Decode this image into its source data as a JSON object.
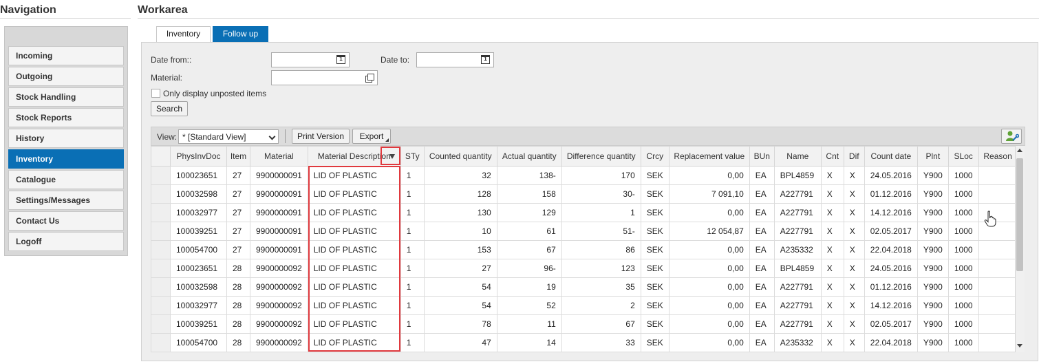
{
  "nav": {
    "title": "Navigation",
    "items": [
      "Incoming",
      "Outgoing",
      "Stock Handling",
      "Stock Reports",
      "History",
      "Inventory",
      "Catalogue",
      "Settings/Messages",
      "Contact Us",
      "Logoff"
    ],
    "active_index": 5
  },
  "work": {
    "title": "Workarea",
    "tabs": [
      "Inventory",
      "Follow up"
    ],
    "active_tab": 1
  },
  "filters": {
    "date_from_label": "Date from::",
    "date_to_label": "Date to:",
    "material_label": "Material:",
    "date_from_value": "",
    "date_to_value": "",
    "material_value": "",
    "checkbox_label": "Only display unposted items",
    "checkbox_checked": false,
    "search_label": "Search"
  },
  "toolbar": {
    "view_label": "View:",
    "view_value": "* [Standard View]",
    "print_label": "Print Version",
    "export_label": "Export"
  },
  "table": {
    "headers": [
      "PhysInvDoc",
      "Item",
      "Material",
      "Material Description",
      "STy",
      "Counted quantity",
      "Actual quantity",
      "Difference quantity",
      "Crcy",
      "Replacement value",
      "BUn",
      "Name",
      "Cnt",
      "Dif",
      "Count date",
      "Plnt",
      "SLoc",
      "Reason"
    ],
    "rows": [
      [
        "100023651",
        "27",
        "9900000091",
        "LID OF PLASTIC",
        "1",
        "32",
        "138-",
        "170",
        "SEK",
        "0,00",
        "EA",
        "BPL4859",
        "X",
        "X",
        "24.05.2016",
        "Y900",
        "1000",
        ""
      ],
      [
        "100032598",
        "27",
        "9900000091",
        "LID OF PLASTIC",
        "1",
        "128",
        "158",
        "30-",
        "SEK",
        "7 091,10",
        "EA",
        "A227791",
        "X",
        "X",
        "01.12.2016",
        "Y900",
        "1000",
        ""
      ],
      [
        "100032977",
        "27",
        "9900000091",
        "LID OF PLASTIC",
        "1",
        "130",
        "129",
        "1",
        "SEK",
        "0,00",
        "EA",
        "A227791",
        "X",
        "X",
        "14.12.2016",
        "Y900",
        "1000",
        ""
      ],
      [
        "100039251",
        "27",
        "9900000091",
        "LID OF PLASTIC",
        "1",
        "10",
        "61",
        "51-",
        "SEK",
        "12 054,87",
        "EA",
        "A227791",
        "X",
        "X",
        "02.05.2017",
        "Y900",
        "1000",
        ""
      ],
      [
        "100054700",
        "27",
        "9900000091",
        "LID OF PLASTIC",
        "1",
        "153",
        "67",
        "86",
        "SEK",
        "0,00",
        "EA",
        "A235332",
        "X",
        "X",
        "22.04.2018",
        "Y900",
        "1000",
        ""
      ],
      [
        "100023651",
        "28",
        "9900000092",
        "LID OF PLASTIC",
        "1",
        "27",
        "96-",
        "123",
        "SEK",
        "0,00",
        "EA",
        "BPL4859",
        "X",
        "X",
        "24.05.2016",
        "Y900",
        "1000",
        ""
      ],
      [
        "100032598",
        "28",
        "9900000092",
        "LID OF PLASTIC",
        "1",
        "54",
        "19",
        "35",
        "SEK",
        "0,00",
        "EA",
        "A227791",
        "X",
        "X",
        "01.12.2016",
        "Y900",
        "1000",
        ""
      ],
      [
        "100032977",
        "28",
        "9900000092",
        "LID OF PLASTIC",
        "1",
        "54",
        "52",
        "2",
        "SEK",
        "0,00",
        "EA",
        "A227791",
        "X",
        "X",
        "14.12.2016",
        "Y900",
        "1000",
        ""
      ],
      [
        "100039251",
        "28",
        "9900000092",
        "LID OF PLASTIC",
        "1",
        "78",
        "11",
        "67",
        "SEK",
        "0,00",
        "EA",
        "A227791",
        "X",
        "X",
        "02.05.2017",
        "Y900",
        "1000",
        ""
      ],
      [
        "100054700",
        "28",
        "9900000092",
        "LID OF PLASTIC",
        "1",
        "47",
        "14",
        "33",
        "SEK",
        "0,00",
        "EA",
        "A235332",
        "X",
        "X",
        "22.04.2018",
        "Y900",
        "1000",
        ""
      ]
    ]
  },
  "colors": {
    "accent": "#0a6fb5",
    "highlight": "#e0393e"
  }
}
